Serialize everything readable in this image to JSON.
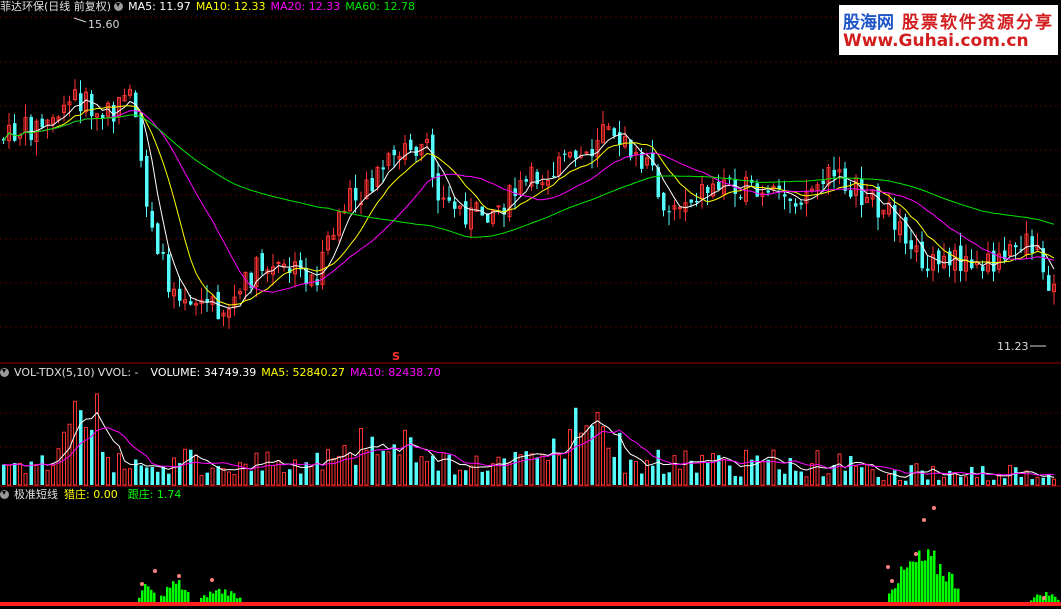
{
  "price_panel": {
    "stock_name": "菲达环保(日线 前复权)",
    "ma5": "MA5: 11.97",
    "ma10": "MA10: 12.33",
    "ma20": "MA20: 12.33",
    "ma60": "MA60: 12.78",
    "high_label": "15.60",
    "low_label": "11.23",
    "marker": "S"
  },
  "volume_panel": {
    "indicator": "VOL-TDX(5,10)",
    "vvol": "VVOL: -",
    "volume": "VOLUME: 34749.39",
    "ma5": "MA5: 52840.27",
    "ma10": "MA10: 82438.70"
  },
  "signal_panel": {
    "name": "极准短线",
    "lie_zhuang": "猎庄: 0.00",
    "gen_zhuang": "跟庄: 1.74"
  },
  "watermark": {
    "line1_a": "股海网",
    "line1_b": "股票软件资源分享",
    "line2": "Www.Guhai.com.cn"
  },
  "colors": {
    "up": "#ff3232",
    "down": "#54fcfc",
    "ma5": "#ffffff",
    "ma10": "#ffff00",
    "ma20": "#ff00ff",
    "ma60": "#00e600",
    "signal_green": "#00ff00",
    "signal_dot": "#ff8080",
    "separator": "#a00000"
  },
  "chart_data": {
    "type": "candlestick",
    "title": "菲达环保(日线 前复权)",
    "price_high": 15.6,
    "price_low": 11.23,
    "series": [
      "MA5",
      "MA10",
      "MA20",
      "MA60",
      "VOLUME",
      "猎庄",
      "跟庄"
    ]
  }
}
